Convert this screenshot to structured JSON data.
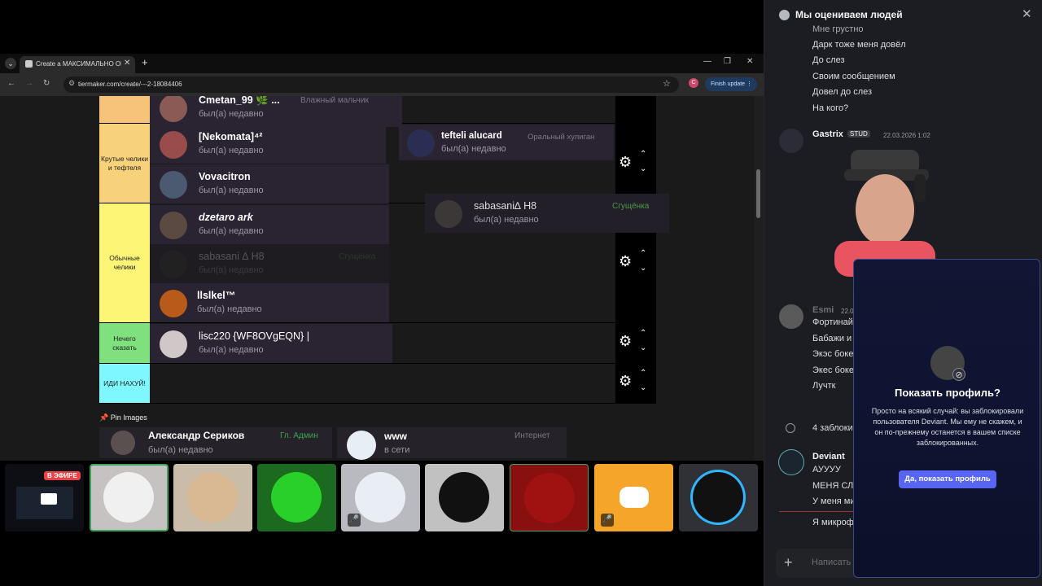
{
  "browser": {
    "tab_title": "Create a МАКСИМАЛЬНО ОБ...",
    "url": "tiermaker.com/create/---2-18084406",
    "finish_update": "Finish update",
    "profile_letter": "C"
  },
  "tiers": [
    {
      "label": "Крутые челики и тефтеля",
      "color": "#f7d27a"
    },
    {
      "label": "Обычные челики",
      "color": "#fdf576"
    },
    {
      "label": "Нечего сказать",
      "color": "#7fe07e"
    },
    {
      "label": "ИДИ НАХУЙ!",
      "color": "#7ff7ff"
    }
  ],
  "top_tier_color": "#f7c27a",
  "cards": {
    "cmetan": {
      "name": "Cmetan_99 🌿 ...",
      "status": "был(а) недавно",
      "role": "Влажный мальчик"
    },
    "nekomata": {
      "name": "[Nekomata]⁴²",
      "status": "был(а) недавно"
    },
    "tefteli": {
      "name": "tefteli alucard",
      "status": "был(а) недавно",
      "role": "Оральный хулиган"
    },
    "vovacitron": {
      "name": "Vovacitron",
      "status": "был(а) недавно"
    },
    "sabasani_drag": {
      "name": "sabasani∆ H8",
      "status": "был(а) недавно",
      "role": "Сгущёнка"
    },
    "dzetaro": {
      "name": "dzetaro ark",
      "status": "был(а) недавно"
    },
    "sabasani_ghost": {
      "name": "sabasani ∆ H8",
      "status": "был(а) недавно",
      "role": "Сгущёнка"
    },
    "llslkel": {
      "name": "llslkel™",
      "status": "был(а) недавно"
    },
    "lisc220": {
      "name": "lisc220 {WF8OVgEQN} |",
      "status": "был(а) недавно"
    }
  },
  "pin": {
    "label": "Pin Images",
    "cards": [
      {
        "name": "Александр Сериков",
        "role": "Гл. Админ",
        "status": "был(а) недавно"
      },
      {
        "name": "www",
        "role": "Интернет",
        "status": "в сети"
      }
    ]
  },
  "stream": {
    "live_badge": "В ЭФИРЕ"
  },
  "chat": {
    "title": "Мы оцениваем людей",
    "early_lines": [
      "Мне грустно",
      "Дарк тоже меня довёл",
      "До слез",
      "Своим сообщением",
      "Довел до слез",
      "На кого?"
    ],
    "gastrix": {
      "author": "Gastrix",
      "tag": "STUD",
      "timestamp": "22.03.2026 1:02"
    },
    "esmi": {
      "author": "Esmi",
      "timestamp": "22.03",
      "lines": [
        "Фортинай",
        "Бабажи и",
        "Экэс боке",
        "Экес боке",
        "Лучтк"
      ]
    },
    "blocked": "4 заблоки",
    "deviant": {
      "author": "Deviant",
      "lines": [
        "АУУУУ",
        "МЕНЯ СЛ",
        "У меня ми"
      ]
    },
    "after_divider": "Я микроф",
    "composer_placeholder": "Написать"
  },
  "modal": {
    "title": "Показать профиль?",
    "text": "Просто на всякий случай: вы заблокировали пользователя Deviant. Мы ему не скажем, и он по-прежнему останется в вашем списке заблокированных.",
    "button": "Да, показать профиль"
  }
}
